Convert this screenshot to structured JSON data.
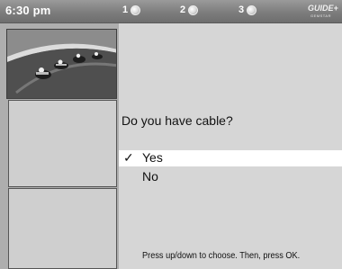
{
  "header": {
    "time": "6:30 pm",
    "steps": [
      {
        "label": "1"
      },
      {
        "label": "2"
      },
      {
        "label": "3"
      }
    ],
    "logo": {
      "text": "GUIDE+",
      "subtext": "GEMSTAR"
    }
  },
  "preview": {
    "icon": "motorcycle-race-video"
  },
  "prompt": {
    "question": "Do you have cable?",
    "options": [
      {
        "label": "Yes",
        "selected": true,
        "mark": "✓"
      },
      {
        "label": "No",
        "selected": false
      }
    ],
    "hint": "Press up/down to choose. Then, press OK."
  },
  "colors": {
    "topbar": "#7d7d7d",
    "panel": "#d6d6d6",
    "left_column": "#aeaeae",
    "highlight": "#ffffff"
  }
}
